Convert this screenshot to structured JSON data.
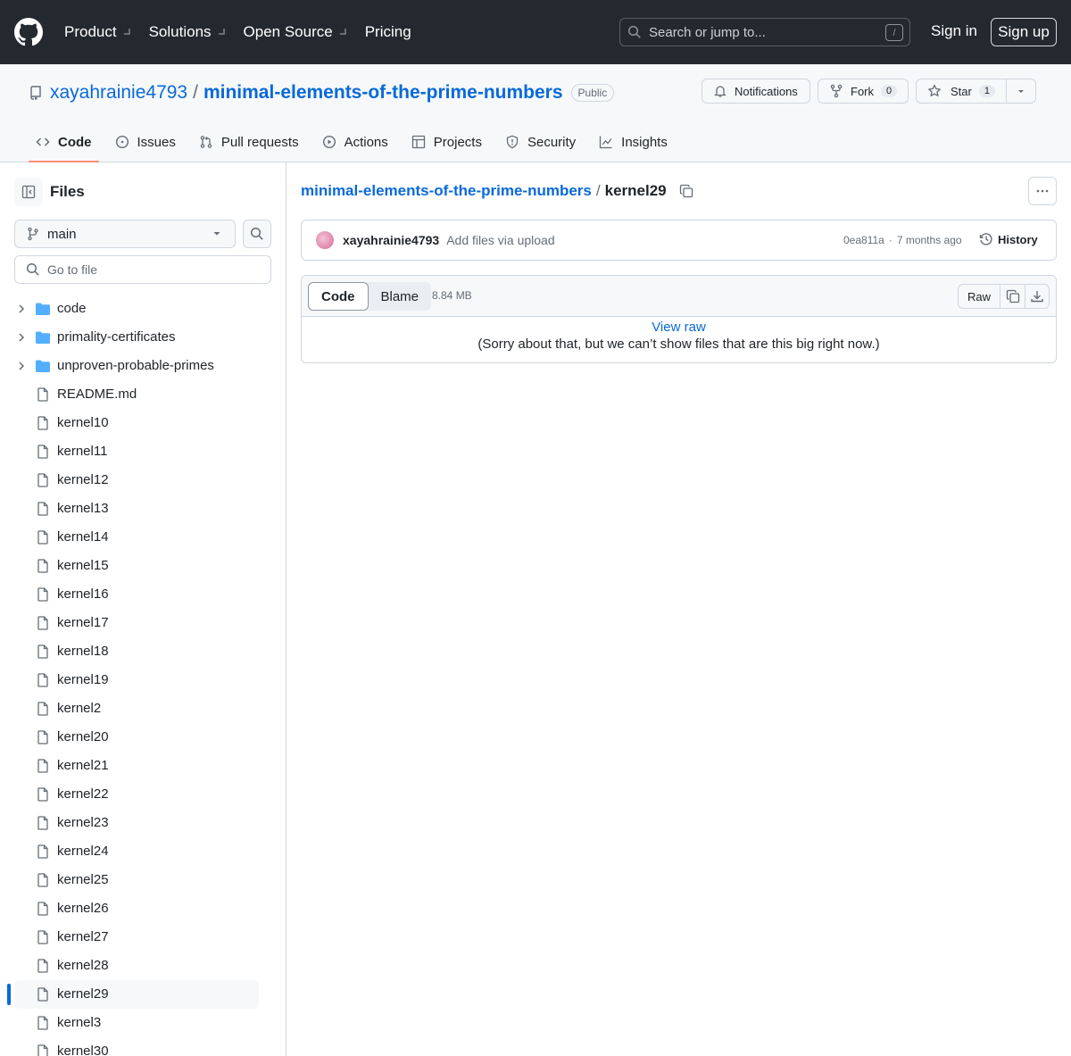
{
  "header": {
    "nav": [
      "Product",
      "Solutions",
      "Open Source",
      "Pricing"
    ],
    "search_placeholder": "Search or jump to...",
    "search_shortcut": "/",
    "sign_in": "Sign in",
    "sign_up": "Sign up"
  },
  "repo": {
    "owner": "xayahrainie4793",
    "separator": "/",
    "name": "minimal-elements-of-the-prime-numbers",
    "visibility": "Public",
    "notifications_label": "Notifications",
    "fork_label": "Fork",
    "fork_count": "0",
    "star_label": "Star",
    "star_count": "1",
    "tabs": [
      {
        "label": "Code",
        "icon": "code-icon",
        "active": true
      },
      {
        "label": "Issues",
        "icon": "issue-icon"
      },
      {
        "label": "Pull requests",
        "icon": "pull-request-icon"
      },
      {
        "label": "Actions",
        "icon": "play-icon"
      },
      {
        "label": "Projects",
        "icon": "table-icon"
      },
      {
        "label": "Security",
        "icon": "shield-icon"
      },
      {
        "label": "Insights",
        "icon": "graph-icon"
      }
    ]
  },
  "sidebar": {
    "title": "Files",
    "branch": "main",
    "goto_placeholder": "Go to file",
    "items": [
      {
        "label": "code",
        "type": "folder"
      },
      {
        "label": "primality-certificates",
        "type": "folder"
      },
      {
        "label": "unproven-probable-primes",
        "type": "folder"
      },
      {
        "label": "README.md",
        "type": "file"
      },
      {
        "label": "kernel10",
        "type": "file"
      },
      {
        "label": "kernel11",
        "type": "file"
      },
      {
        "label": "kernel12",
        "type": "file"
      },
      {
        "label": "kernel13",
        "type": "file"
      },
      {
        "label": "kernel14",
        "type": "file"
      },
      {
        "label": "kernel15",
        "type": "file"
      },
      {
        "label": "kernel16",
        "type": "file"
      },
      {
        "label": "kernel17",
        "type": "file"
      },
      {
        "label": "kernel18",
        "type": "file"
      },
      {
        "label": "kernel19",
        "type": "file"
      },
      {
        "label": "kernel2",
        "type": "file"
      },
      {
        "label": "kernel20",
        "type": "file"
      },
      {
        "label": "kernel21",
        "type": "file"
      },
      {
        "label": "kernel22",
        "type": "file"
      },
      {
        "label": "kernel23",
        "type": "file"
      },
      {
        "label": "kernel24",
        "type": "file"
      },
      {
        "label": "kernel25",
        "type": "file"
      },
      {
        "label": "kernel26",
        "type": "file"
      },
      {
        "label": "kernel27",
        "type": "file"
      },
      {
        "label": "kernel28",
        "type": "file"
      },
      {
        "label": "kernel29",
        "type": "file",
        "selected": true
      },
      {
        "label": "kernel3",
        "type": "file"
      },
      {
        "label": "kernel30",
        "type": "file"
      }
    ]
  },
  "main": {
    "breadcrumb_repo": "minimal-elements-of-the-prime-numbers",
    "breadcrumb_sep": "/",
    "breadcrumb_file": "kernel29",
    "commit": {
      "author": "xayahrainie4793",
      "message": "Add files via upload",
      "sha": "0ea811a",
      "dot": "·",
      "time": "7 months ago",
      "history_label": "History"
    },
    "file": {
      "tab_code": "Code",
      "tab_blame": "Blame",
      "size": "8.84 MB",
      "raw_label": "Raw",
      "view_raw": "View raw",
      "too_big_message": "(Sorry about that, but we can’t show files that are this big right now.)"
    }
  },
  "colors": {
    "header_bg": "#24292f",
    "link": "#0969da",
    "tab_underline": "#fd8c73",
    "folder": "#54aeff"
  }
}
